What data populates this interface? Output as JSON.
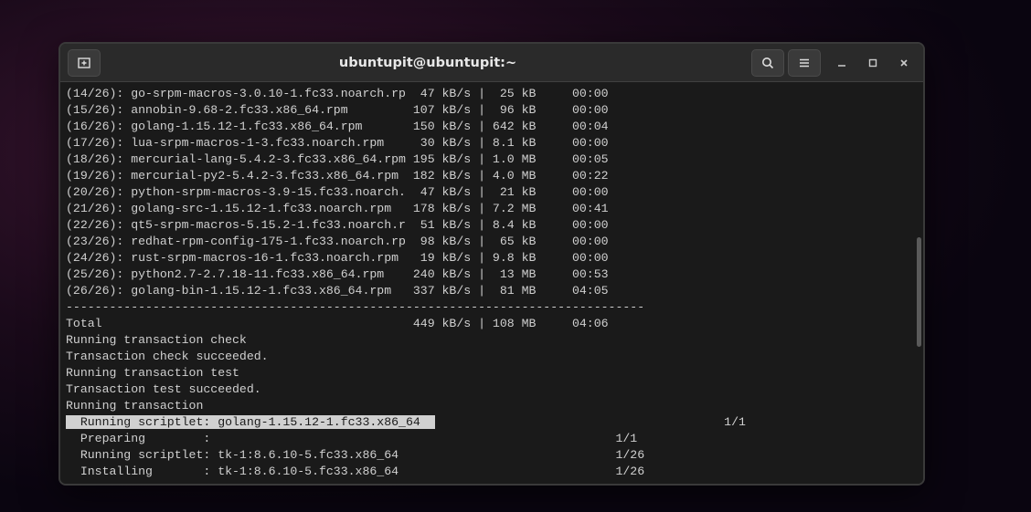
{
  "window_title": "ubuntupit@ubuntupit:~",
  "download_lines": [
    "(14/26): go-srpm-macros-3.0.10-1.fc33.noarch.rp  47 kB/s |  25 kB     00:00    ",
    "(15/26): annobin-9.68-2.fc33.x86_64.rpm         107 kB/s |  96 kB     00:00    ",
    "(16/26): golang-1.15.12-1.fc33.x86_64.rpm       150 kB/s | 642 kB     00:04    ",
    "(17/26): lua-srpm-macros-1-3.fc33.noarch.rpm     30 kB/s | 8.1 kB     00:00    ",
    "(18/26): mercurial-lang-5.4.2-3.fc33.x86_64.rpm 195 kB/s | 1.0 MB     00:05    ",
    "(19/26): mercurial-py2-5.4.2-3.fc33.x86_64.rpm  182 kB/s | 4.0 MB     00:22    ",
    "(20/26): python-srpm-macros-3.9-15.fc33.noarch.  47 kB/s |  21 kB     00:00    ",
    "(21/26): golang-src-1.15.12-1.fc33.noarch.rpm   178 kB/s | 7.2 MB     00:41    ",
    "(22/26): qt5-srpm-macros-5.15.2-1.fc33.noarch.r  51 kB/s | 8.4 kB     00:00    ",
    "(23/26): redhat-rpm-config-175-1.fc33.noarch.rp  98 kB/s |  65 kB     00:00    ",
    "(24/26): rust-srpm-macros-16-1.fc33.noarch.rpm   19 kB/s | 9.8 kB     00:00    ",
    "(25/26): python2.7-2.7.18-11.fc33.x86_64.rpm    240 kB/s |  13 MB     00:53    ",
    "(26/26): golang-bin-1.15.12-1.fc33.x86_64.rpm   337 kB/s |  81 MB     04:05    "
  ],
  "divider": "--------------------------------------------------------------------------------",
  "total_line": "Total                                           449 kB/s | 108 MB     04:06     ",
  "status_lines": [
    "Running transaction check",
    "Transaction check succeeded.",
    "Running transaction test",
    "Transaction test succeeded.",
    "Running transaction"
  ],
  "highlighted_line": "  Running scriptlet: golang-1.15.12-1.fc33.x86_64                                          1/1 ",
  "post_lines": [
    "  Preparing        :                                                        1/1 ",
    "  Running scriptlet: tk-1:8.6.10-5.fc33.x86_64                              1/26 ",
    "  Installing       : tk-1:8.6.10-5.fc33.x86_64                              1/26 "
  ]
}
